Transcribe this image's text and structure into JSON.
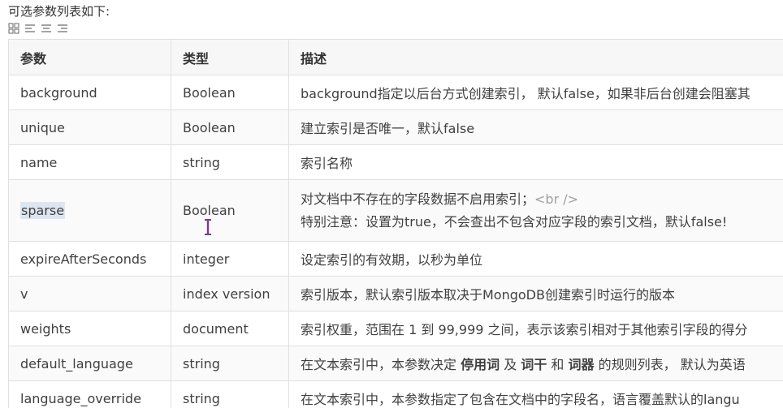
{
  "intro": "可选参数列表如下:",
  "toolbar_icons": [
    "grid-icon",
    "align-left-icon",
    "align-center-icon",
    "align-right-icon"
  ],
  "table": {
    "headers": [
      "参数",
      "类型",
      "描述"
    ],
    "rows": [
      {
        "param": "background",
        "type": "Boolean",
        "desc": "background指定以后台方式创建索引， 默认false，如果非后台创建会阻塞其"
      },
      {
        "param": "unique",
        "type": "Boolean",
        "desc": "建立索引是否唯一，默认false"
      },
      {
        "param": "name",
        "type": "string",
        "desc": "索引名称"
      },
      {
        "param": "sparse",
        "type": "Boolean",
        "desc_line1_text": "对文档中不存在的字段数据不启用索引；",
        "desc_line1_code": "<br />",
        "desc_line2": "特别注意：设置为true，不会查出不包含对应字段的索引文档，默认false!"
      },
      {
        "param": "expireAfterSeconds",
        "type": "integer",
        "desc": "设定索引的有效期，以秒为单位"
      },
      {
        "param": "v",
        "type": "index version",
        "desc": "索引版本，默认索引版本取决于MongoDB创建索引时运行的版本"
      },
      {
        "param": "weights",
        "type": "document",
        "desc": "索引权重，范围在 1 到 99,999 之间，表示该索引相对于其他索引字段的得分"
      },
      {
        "param": "default_language",
        "type": "string",
        "desc_a": "在文本索引中，本参数决定 ",
        "desc_b1": "停用词",
        "desc_c": " 及 ",
        "desc_b2": "词干",
        "desc_d": " 和 ",
        "desc_b3": "词器",
        "desc_e": " 的规则列表， 默认为英语"
      },
      {
        "param": "language_override",
        "type": "string",
        "desc": "在文本索引中，本参数指定了包含在文档中的字段名，语言覆盖默认的langu"
      }
    ]
  },
  "colors": {
    "header_bg": "#f7f7f7",
    "border": "#e0e0e0",
    "highlight": "#dde6f0",
    "cursor": "#7a3b8f"
  }
}
